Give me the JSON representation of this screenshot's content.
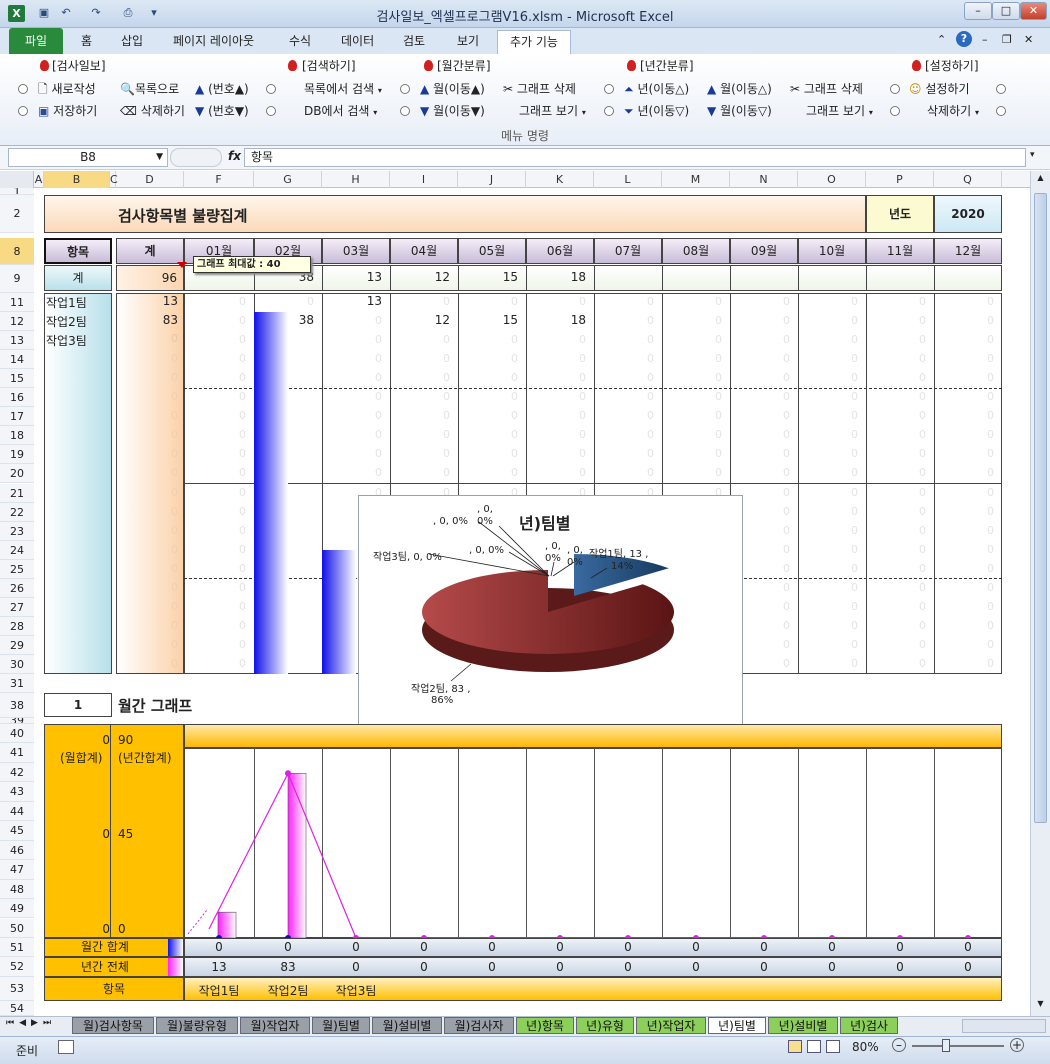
{
  "window": {
    "title": "검사일보_엑셀프로그램V16.xlsm  -  Microsoft Excel"
  },
  "ribbon": {
    "tabs": [
      "파일",
      "홈",
      "삽입",
      "페이지 레이아웃",
      "수식",
      "데이터",
      "검토",
      "보기",
      "추가 기능"
    ],
    "groups": {
      "inspection": {
        "title": "[검사일보]",
        "new": "새로작성",
        "save": "저장하기",
        "list": "목록으로",
        "delete": "삭제하기",
        "num_up": "(번호▲)",
        "num_down": "(번호▼)"
      },
      "search": {
        "title": "[검색하기]",
        "list_search": "목록에서 검색",
        "db_search": "DB에서 검색"
      },
      "monthly": {
        "title": "[월간분류]",
        "month_up": "월(이동▲)",
        "month_down": "월(이동▼)",
        "graph_delete": "그래프 삭제",
        "graph_view": "그래프 보기"
      },
      "yearly": {
        "title": "[년간분류]",
        "year_up": "년(이동△)",
        "year_down": "년(이동▽)",
        "month_up": "월(이동△)",
        "month_down": "월(이동▽)",
        "graph_delete": "그래프 삭제",
        "graph_view": "그래프 보기"
      },
      "settings": {
        "title": "[설정하기]",
        "setup": "설정하기",
        "delete": "삭제하기"
      }
    },
    "group_label": "메뉴 명령"
  },
  "formula_bar": {
    "name_box": "B8",
    "fx": "fx",
    "content": "항목"
  },
  "columns": [
    "A",
    "B",
    "C",
    "D",
    "F",
    "G",
    "H",
    "I",
    "J",
    "K",
    "L",
    "M",
    "N",
    "O",
    "P",
    "Q"
  ],
  "rows": [
    "1",
    "2",
    "8",
    "9",
    "11",
    "12",
    "13",
    "14",
    "15",
    "16",
    "17",
    "18",
    "19",
    "20",
    "21",
    "22",
    "23",
    "24",
    "25",
    "26",
    "27",
    "28",
    "29",
    "30",
    "31",
    "38",
    "39",
    "40",
    "41",
    "42",
    "43",
    "44",
    "45",
    "46",
    "47",
    "48",
    "49",
    "50",
    "51",
    "52",
    "53",
    "54"
  ],
  "sheet": {
    "title": "검사항목별 불량집계",
    "year_label": "년도",
    "year": "2020",
    "header_item": "항목",
    "header_total": "계",
    "months": [
      "01월",
      "02월",
      "03월",
      "04월",
      "05월",
      "06월",
      "07월",
      "08월",
      "09월",
      "10월",
      "11월",
      "12월"
    ],
    "total_label": "계",
    "grand_total": "96",
    "month_totals": [
      "",
      "38",
      "13",
      "12",
      "15",
      "18",
      "",
      "",
      "",
      "",
      "",
      ""
    ],
    "tooltip": "그래프 최대값 : 40",
    "teams": [
      {
        "name": "작업1팀",
        "total": "13",
        "months": [
          "",
          "",
          "13",
          "",
          "",
          "",
          "",
          "",
          "",
          "",
          "",
          ""
        ]
      },
      {
        "name": "작업2팀",
        "total": "83",
        "months": [
          "",
          "38",
          "",
          "12",
          "15",
          "18",
          "",
          "",
          "",
          "",
          "",
          ""
        ]
      },
      {
        "name": "작업3팀",
        "total": "0",
        "months": [
          "",
          "",
          "",
          "",
          "",
          "",
          "",
          "",
          "",
          "",
          "",
          ""
        ]
      }
    ],
    "ghost_zero": "0",
    "graph_index": "1",
    "graph_title": "월간 그래프",
    "axis_left": {
      "top": "0",
      "mid": "0",
      "bottom": "0",
      "label": "(월합계)"
    },
    "axis_right": {
      "top": "90",
      "mid": "45",
      "bottom": "0",
      "label": "(년간합계)"
    },
    "monthly_sum_label": "월간 합계",
    "yearly_total_label": "년간 전체",
    "item_label": "항목",
    "monthly_sums": [
      "0",
      "0",
      "0",
      "0",
      "0",
      "0",
      "0",
      "0",
      "0",
      "0",
      "0",
      "0"
    ],
    "yearly_totals": [
      "13",
      "83",
      "0",
      "0",
      "0",
      "0",
      "0",
      "0",
      "0",
      "0",
      "0",
      "0"
    ],
    "bottom_items": [
      "작업1팀",
      "작업2팀",
      "작업3팀",
      "",
      "",
      "",
      "",
      "",
      "",
      "",
      "",
      ""
    ]
  },
  "chart_data": [
    {
      "type": "pie",
      "title": "년)팀별",
      "slices": [
        {
          "label": "작업1팀",
          "value": 13,
          "percent": "14%",
          "text": "작업1팀, 13 ,"
        },
        {
          "label": "작업2팀",
          "value": 83,
          "percent": "86%",
          "text": "작업2팀, 83 ,"
        },
        {
          "label": "작업3팀",
          "value": 0,
          "percent": "0%",
          "text": "작업3팀, 0, 0%"
        }
      ],
      "zero_labels": [
        ", 0, 0%",
        ", 0,",
        "0%",
        ", 0, 0%",
        ", 0,",
        "0%",
        ", 0,",
        "0%"
      ],
      "colors": {
        "작업1팀": "#1f4e79",
        "작업2팀": "#8b2b2b"
      }
    },
    {
      "type": "bar",
      "title": "월간 그래프",
      "categories": [
        "작업1팀",
        "작업2팀",
        "작업3팀",
        "",
        "",
        "",
        "",
        "",
        "",
        "",
        "",
        ""
      ],
      "series": [
        {
          "name": "년간 전체",
          "values": [
            13,
            83,
            0,
            0,
            0,
            0,
            0,
            0,
            0,
            0,
            0,
            0
          ]
        },
        {
          "name": "월간 합계",
          "values": [
            0,
            0,
            0,
            0,
            0,
            0,
            0,
            0,
            0,
            0,
            0,
            0
          ]
        }
      ],
      "ylim": [
        0,
        90
      ],
      "yticks": [
        "0",
        "45",
        "90"
      ]
    }
  ],
  "status": {
    "ready": "준비",
    "zoom": "80%"
  },
  "sheet_tabs": [
    "월)검사항목",
    "월)불량유형",
    "월)작업자",
    "월)팀별",
    "월)설비별",
    "월)검사자",
    "년)항목",
    "년)유형",
    "년)작업자",
    "년)팀별",
    "년)설비별",
    "년)검사"
  ],
  "active_sheet": "년)팀별"
}
